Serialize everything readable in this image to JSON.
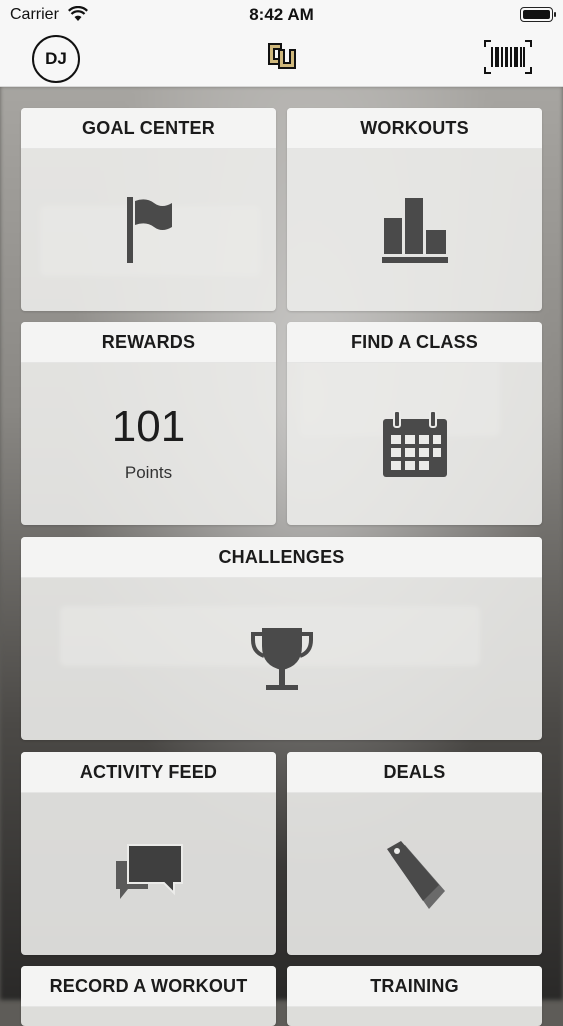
{
  "status_bar": {
    "carrier": "Carrier",
    "time": "8:42 AM"
  },
  "navbar": {
    "avatar_initials": "DJ",
    "logo": "cu-logo-icon",
    "scan": "barcode-icon"
  },
  "tiles": {
    "goal_center": {
      "label": "GOAL CENTER",
      "icon": "flag-icon"
    },
    "workouts": {
      "label": "WORKOUTS",
      "icon": "bar-chart-icon"
    },
    "rewards": {
      "label": "REWARDS",
      "points_value": "101",
      "points_label": "Points"
    },
    "find_a_class": {
      "label": "FIND A CLASS",
      "icon": "calendar-icon"
    },
    "challenges": {
      "label": "CHALLENGES",
      "icon": "trophy-icon"
    },
    "activity_feed": {
      "label": "ACTIVITY FEED",
      "icon": "chat-bubbles-icon"
    },
    "deals": {
      "label": "DEALS",
      "icon": "tag-icon"
    },
    "record_a_workout": {
      "label": "RECORD A WORKOUT"
    },
    "training": {
      "label": "TRAINING"
    }
  },
  "colors": {
    "icon": "#4a4a4a",
    "tile_bg": "#ebebe9",
    "header_bg": "#f7f7f7",
    "logo_gold": "#cfb87c"
  }
}
